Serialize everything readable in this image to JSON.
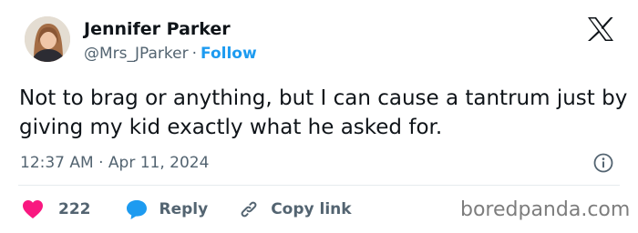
{
  "author": {
    "name": "Jennifer Parker",
    "handle": "@Mrs_JParker",
    "separator": "·",
    "follow_label": "Follow"
  },
  "tweet": {
    "text": "Not to brag or anything, but I can cause a tantrum just by giving my kid exactly what he asked for.",
    "timestamp": "12:37 AM · Apr 11, 2024"
  },
  "actions": {
    "likes": "222",
    "reply_label": "Reply",
    "copy_link_label": "Copy link"
  },
  "watermark": "boredpanda.com",
  "icons": {
    "logo": "x-logo-icon",
    "info": "info-icon",
    "like": "heart-icon",
    "reply": "speech-bubble-icon",
    "copy": "link-icon"
  },
  "colors": {
    "like": "#f91880",
    "reply": "#1d9bf0",
    "follow": "#1d9bf0",
    "text": "#0f1419",
    "secondary": "#536471"
  }
}
